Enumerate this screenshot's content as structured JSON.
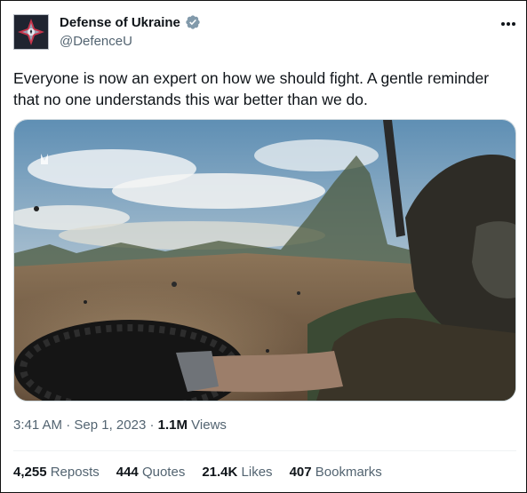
{
  "account": {
    "display_name": "Defense of Ukraine",
    "handle": "@DefenceU",
    "verified": true,
    "avatar_icon": "defence-emblem-icon"
  },
  "tweet": {
    "text": "Everyone is now an expert on how we should fight. A gentle reminder\nthat no one understands this war better than we do.",
    "media": {
      "type": "video-still",
      "description_icon": "video-frame"
    },
    "time": "3:41 AM",
    "separator": "·",
    "date": "Sep 1, 2023",
    "views_count": "1.1M",
    "views_label": "Views"
  },
  "stats": [
    {
      "count": "4,255",
      "label": "Reposts"
    },
    {
      "count": "444",
      "label": "Quotes"
    },
    {
      "count": "21.4K",
      "label": "Likes"
    },
    {
      "count": "407",
      "label": "Bookmarks"
    }
  ],
  "colors": {
    "verified_badge": "#829aab",
    "text_primary": "#0f1419",
    "text_secondary": "#536471",
    "divider": "#eff3f4"
  }
}
